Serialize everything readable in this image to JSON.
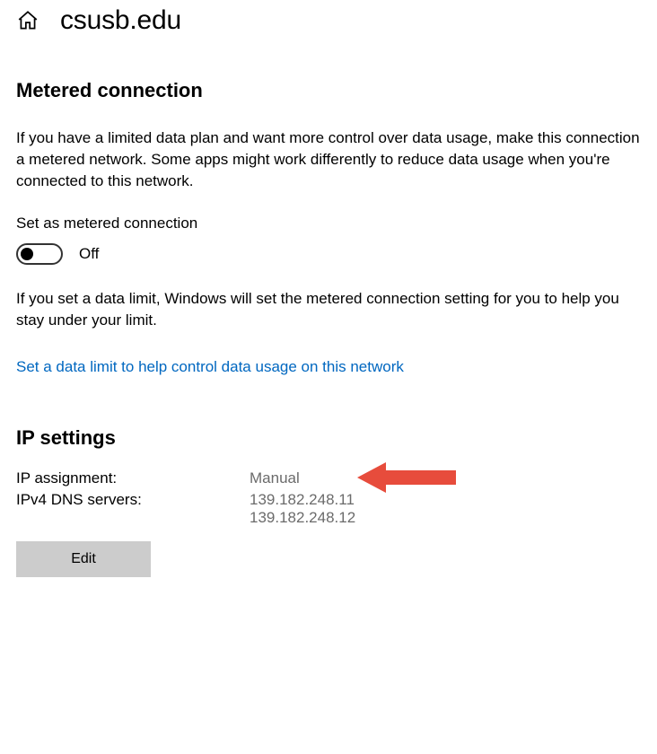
{
  "header": {
    "title": "csusb.edu"
  },
  "metered": {
    "heading": "Metered connection",
    "description": "If you have a limited data plan and want more control over data usage, make this connection a metered network. Some apps might work differently to reduce data usage when you're connected to this network.",
    "toggle_label": "Set as metered connection",
    "toggle_state": "Off",
    "limit_note": "If you set a data limit, Windows will set the metered connection setting for you to help you stay under your limit.",
    "limit_link": "Set a data limit to help control data usage on this network"
  },
  "ip": {
    "heading": "IP settings",
    "assignment_label": "IP assignment:",
    "assignment_value": "Manual",
    "dns_label": "IPv4 DNS servers:",
    "dns_value_1": "139.182.248.11",
    "dns_value_2": "139.182.248.12",
    "edit_button": "Edit"
  },
  "annotation": {
    "arrow_color": "#e74c3c"
  }
}
